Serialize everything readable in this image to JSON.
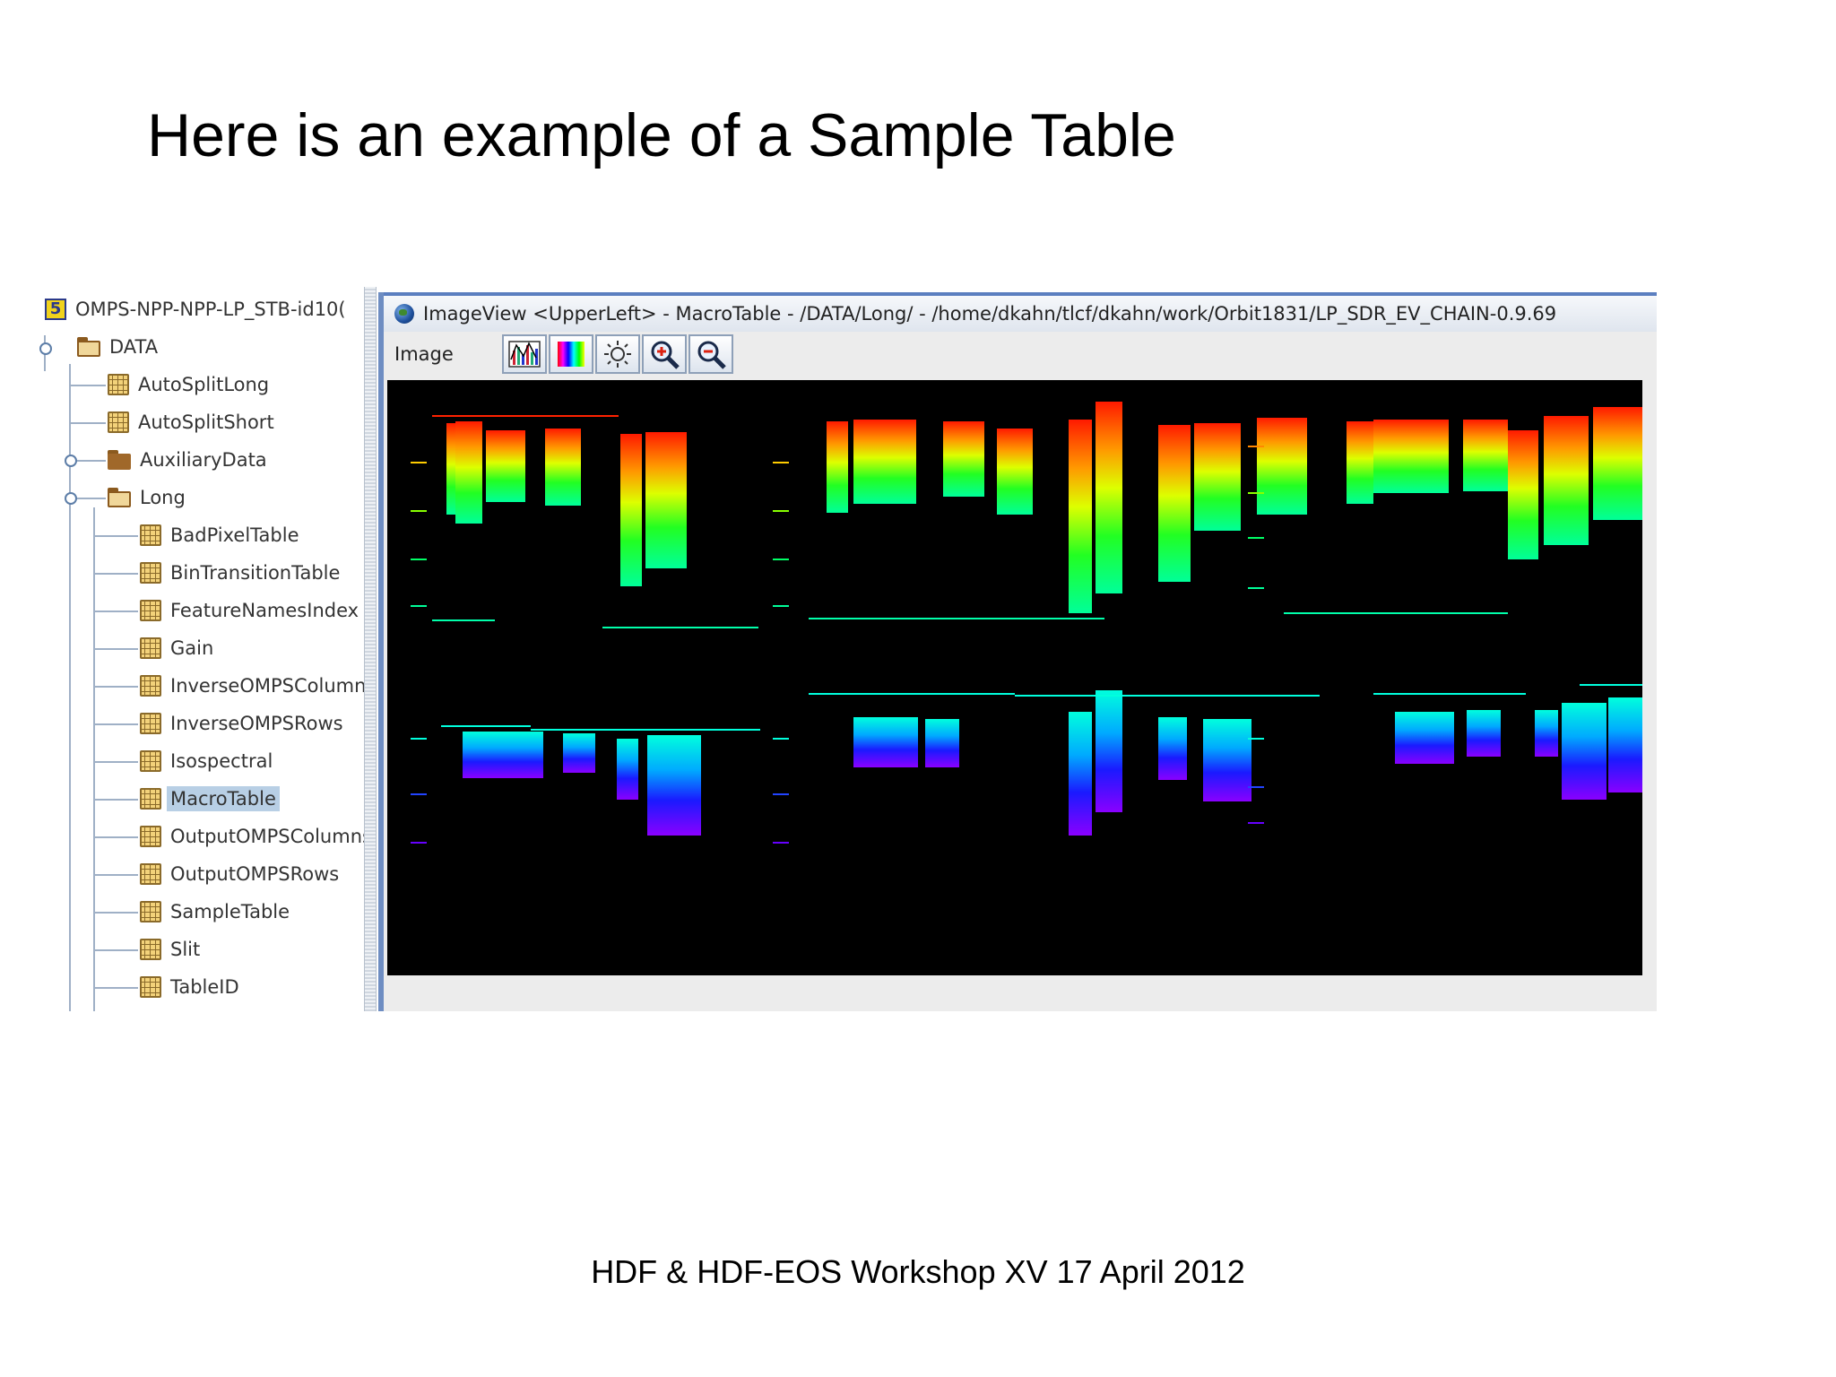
{
  "slide": {
    "title": "Here is an example of a Sample Table",
    "footer": "HDF & HDF-EOS Workshop XV 17 April 2012"
  },
  "tree": {
    "root": {
      "label": "OMPS-NPP-NPP-LP_STB-id10(",
      "icon": "hdf5-file-icon"
    },
    "data_group": "DATA",
    "items": [
      {
        "label": "AutoSplitLong",
        "icon": "dataset-icon"
      },
      {
        "label": "AutoSplitShort",
        "icon": "dataset-icon"
      },
      {
        "label": "AuxiliaryData",
        "icon": "folder-icon"
      },
      {
        "label": "Long",
        "icon": "folder-open-icon"
      },
      {
        "label": "BadPixelTable",
        "icon": "dataset-icon"
      },
      {
        "label": "BinTransitionTable",
        "icon": "dataset-icon"
      },
      {
        "label": "FeatureNamesIndex",
        "icon": "dataset-icon"
      },
      {
        "label": "Gain",
        "icon": "dataset-icon"
      },
      {
        "label": "InverseOMPSColumn",
        "icon": "dataset-icon"
      },
      {
        "label": "InverseOMPSRows",
        "icon": "dataset-icon"
      },
      {
        "label": "Isospectral",
        "icon": "dataset-icon"
      },
      {
        "label": "MacroTable",
        "icon": "dataset-icon",
        "selected": true
      },
      {
        "label": "OutputOMPSColumns",
        "icon": "dataset-icon"
      },
      {
        "label": "OutputOMPSRows",
        "icon": "dataset-icon"
      },
      {
        "label": "SampleTable",
        "icon": "dataset-icon"
      },
      {
        "label": "Slit",
        "icon": "dataset-icon"
      },
      {
        "label": "TableID",
        "icon": "dataset-icon"
      }
    ]
  },
  "image_window": {
    "title": "ImageView <UpperLeft>  -  MacroTable  -  /DATA/Long/  -  /home/dkahn/tlcf/dkahn/work/Orbit1831/LP_SDR_EV_CHAIN-0.9.69",
    "menu": "Image",
    "toolbar": [
      "histogram-icon",
      "palette-icon",
      "brightness-icon",
      "zoom-in-icon",
      "zoom-out-icon"
    ]
  },
  "colors": {
    "selection": "#b8cfe5",
    "window_border": "#6e8dc2",
    "image_background": "#000000"
  }
}
